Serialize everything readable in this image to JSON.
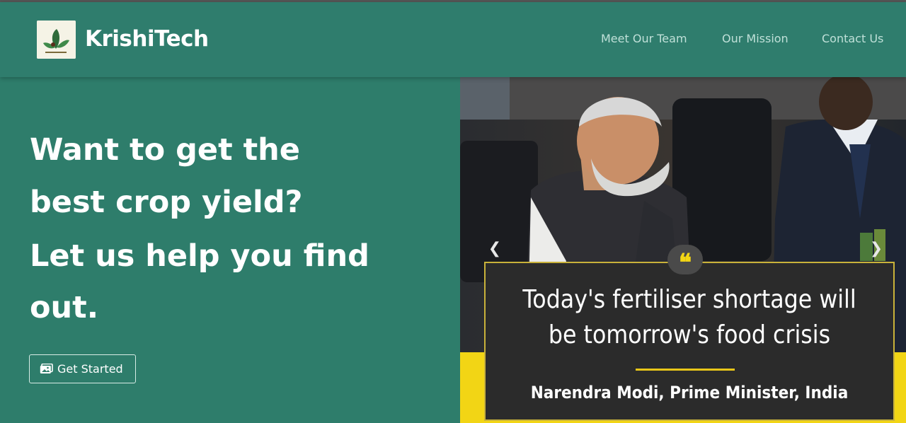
{
  "navbar": {
    "brand_name": "KrishiTech",
    "logo_icon": "leaf-icon",
    "links": [
      {
        "label": "Meet Our Team"
      },
      {
        "label": "Our Mission"
      },
      {
        "label": "Contact Us"
      }
    ]
  },
  "hero": {
    "headline_line1": "Want to get the",
    "headline_line2": "best crop yield?",
    "subline_line1": "Let us help you find",
    "subline_line2": "out.",
    "cta_label": "Get Started",
    "cta_icon": "images-icon"
  },
  "carousel": {
    "quote_text_line1": "Today's fertiliser shortage will",
    "quote_text_line2": "be tomorrow's food crisis",
    "quote_author": "Narendra Modi, Prime Minister, India",
    "prev_icon": "chevron-left-icon",
    "next_icon": "chevron-right-icon"
  },
  "colors": {
    "primary": "#2e7d6b",
    "accent": "#f2d515",
    "quote_bg": "#2b2b2b"
  }
}
